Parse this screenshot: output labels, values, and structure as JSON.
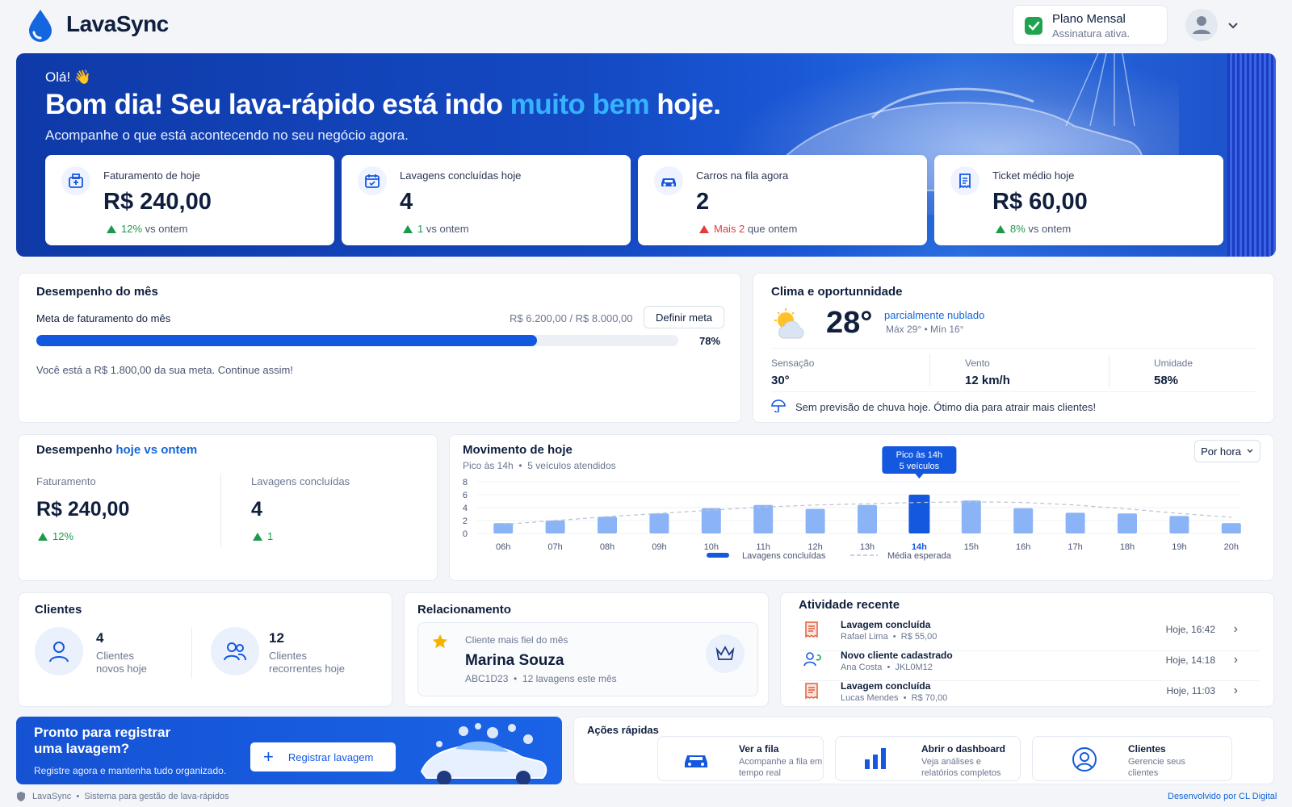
{
  "header": {
    "brand": "LavaSync",
    "plan_title": "Plano Mensal",
    "plan_status": "Assinatura ativa."
  },
  "hero": {
    "greeting": "Olá! 👋",
    "headline_pre": "Bom dia! Seu lava-rápido está indo ",
    "headline_accent": "muito bem",
    "headline_post": " hoje.",
    "subtitle": "Acompanhe o que está acontecendo no seu negócio agora."
  },
  "kpis": [
    {
      "label": "Faturamento de hoje",
      "value": "R$ 240,00",
      "delta_value": "12%",
      "delta_text": "vs ontem",
      "icon": "register-icon"
    },
    {
      "label": "Lavagens concluídas hoje",
      "value": "4",
      "delta_value": "1",
      "delta_text": "vs ontem",
      "icon": "calendar-icon"
    },
    {
      "label": "Carros na fila agora",
      "value": "2",
      "delta_value": "Mais 2",
      "delta_text": "que ontem",
      "icon": "car-icon"
    },
    {
      "label": "Ticket médio hoje",
      "value": "R$ 60,00",
      "delta_value": "8%",
      "delta_text": "vs ontem",
      "icon": "receipt-icon"
    }
  ],
  "month": {
    "title": "Desempenho do mês",
    "goal_label": "Meta de faturamento do mês",
    "goal_amount": "R$ 6.200,00 / R$ 8.000,00",
    "set_goal_button": "Definir meta",
    "progress": 0.78,
    "progress_label": "78%",
    "message": "Você está a R$ 1.800,00 da sua meta. Continue assim!"
  },
  "weather": {
    "title": "Clima e oportunnidade",
    "temp": "28°",
    "condition": "parcialmente nublado",
    "minmax": "Máx 29° • Mín 16°",
    "stats": [
      {
        "label": "Sensação",
        "value": "30°"
      },
      {
        "label": "Vento",
        "value": "12 km/h"
      },
      {
        "label": "Umidade",
        "value": "58%"
      }
    ],
    "tip": "Sem previsão de chuva hoje. Ótimo dia para atrair mais clientes!"
  },
  "compare": {
    "title_pre": "Desempenho ",
    "title_accent": "hoje vs ontem",
    "items": [
      {
        "label": "Faturamento",
        "value": "R$ 240,00",
        "delta": "12%"
      },
      {
        "label": "Lavagens concluídas",
        "value": "4",
        "delta": "1"
      }
    ]
  },
  "movement": {
    "title": "Movimento de hoje",
    "subtitle": "Pico às 14h  •  5 veículos atendidos",
    "dropdown": "Por hora",
    "tooltip_line1": "Pico às 14h",
    "tooltip_line2": "5 veículos"
  },
  "chart_data": {
    "type": "bar",
    "categories": [
      "06h",
      "07h",
      "08h",
      "09h",
      "10h",
      "11h",
      "12h",
      "13h",
      "14h",
      "15h",
      "16h",
      "17h",
      "18h",
      "19h",
      "20h"
    ],
    "series": [
      {
        "name": "Lavagens concluídas",
        "values": [
          1.6,
          2.0,
          2.6,
          3.1,
          3.9,
          4.4,
          3.8,
          4.4,
          6.0,
          5.1,
          3.9,
          3.2,
          3.1,
          2.7,
          1.6
        ]
      },
      {
        "name": "Média esperada",
        "values": [
          1.4,
          2.0,
          2.6,
          3.1,
          3.6,
          4.1,
          4.4,
          4.6,
          4.8,
          4.9,
          4.8,
          4.4,
          3.8,
          3.1,
          2.5
        ]
      }
    ],
    "highlight": "14h",
    "ylim": [
      0,
      8
    ],
    "yticks": [
      0,
      2,
      4,
      6,
      8
    ],
    "grid": true,
    "legend": "bottom"
  },
  "clients": {
    "title": "Clientes",
    "items": [
      {
        "count": "4",
        "line1": "Clientes",
        "line2": "novos hoje"
      },
      {
        "count": "12",
        "line1": "Clientes",
        "line2": "recorrentes hoje"
      }
    ]
  },
  "relationship": {
    "title": "Relacionamento",
    "label": "Cliente mais fiel do mês",
    "name": "Marina Souza",
    "detail": "ABC1D23  •  12 lavagens este mês"
  },
  "activity": {
    "title": "Atividade recente",
    "items": [
      {
        "title": "Lavagem concluída",
        "sub": "Rafael Lima  •  R$ 55,00",
        "time": "Hoje, 16:42"
      },
      {
        "title": "Novo cliente cadastrado",
        "sub": "Ana Costa  •  JKL0M12",
        "time": "Hoje, 14:18"
      },
      {
        "title": "Lavagem concluída",
        "sub": "Lucas Mendes  •  R$ 70,00",
        "time": "Hoje, 11:03"
      }
    ]
  },
  "cta": {
    "title_line1": "Pronto para registrar",
    "title_line2": "uma lavagem?",
    "subtitle": "Registre agora e mantenha tudo organizado.",
    "button": "Registrar lavagem"
  },
  "quick": {
    "title": "Ações rápidas",
    "items": [
      {
        "title": "Ver a fila",
        "sub": "Acompanhe a fila em tempo real"
      },
      {
        "title": "Abrir o dashboard",
        "sub": "Veja análises e relatórios completos"
      },
      {
        "title": "Clientes",
        "sub": "Gerencie seus clientes"
      }
    ]
  },
  "footer": {
    "left": "LavaSync  •  Sistema para gestão de lava-rápidos",
    "right": "Desenvolvido por CL Digital"
  },
  "colors": {
    "primary": "#1458e0",
    "accent": "#35b3ff",
    "navy": "#0f1f3d",
    "up": "#1a9a4c",
    "down": "#e23b3b"
  }
}
